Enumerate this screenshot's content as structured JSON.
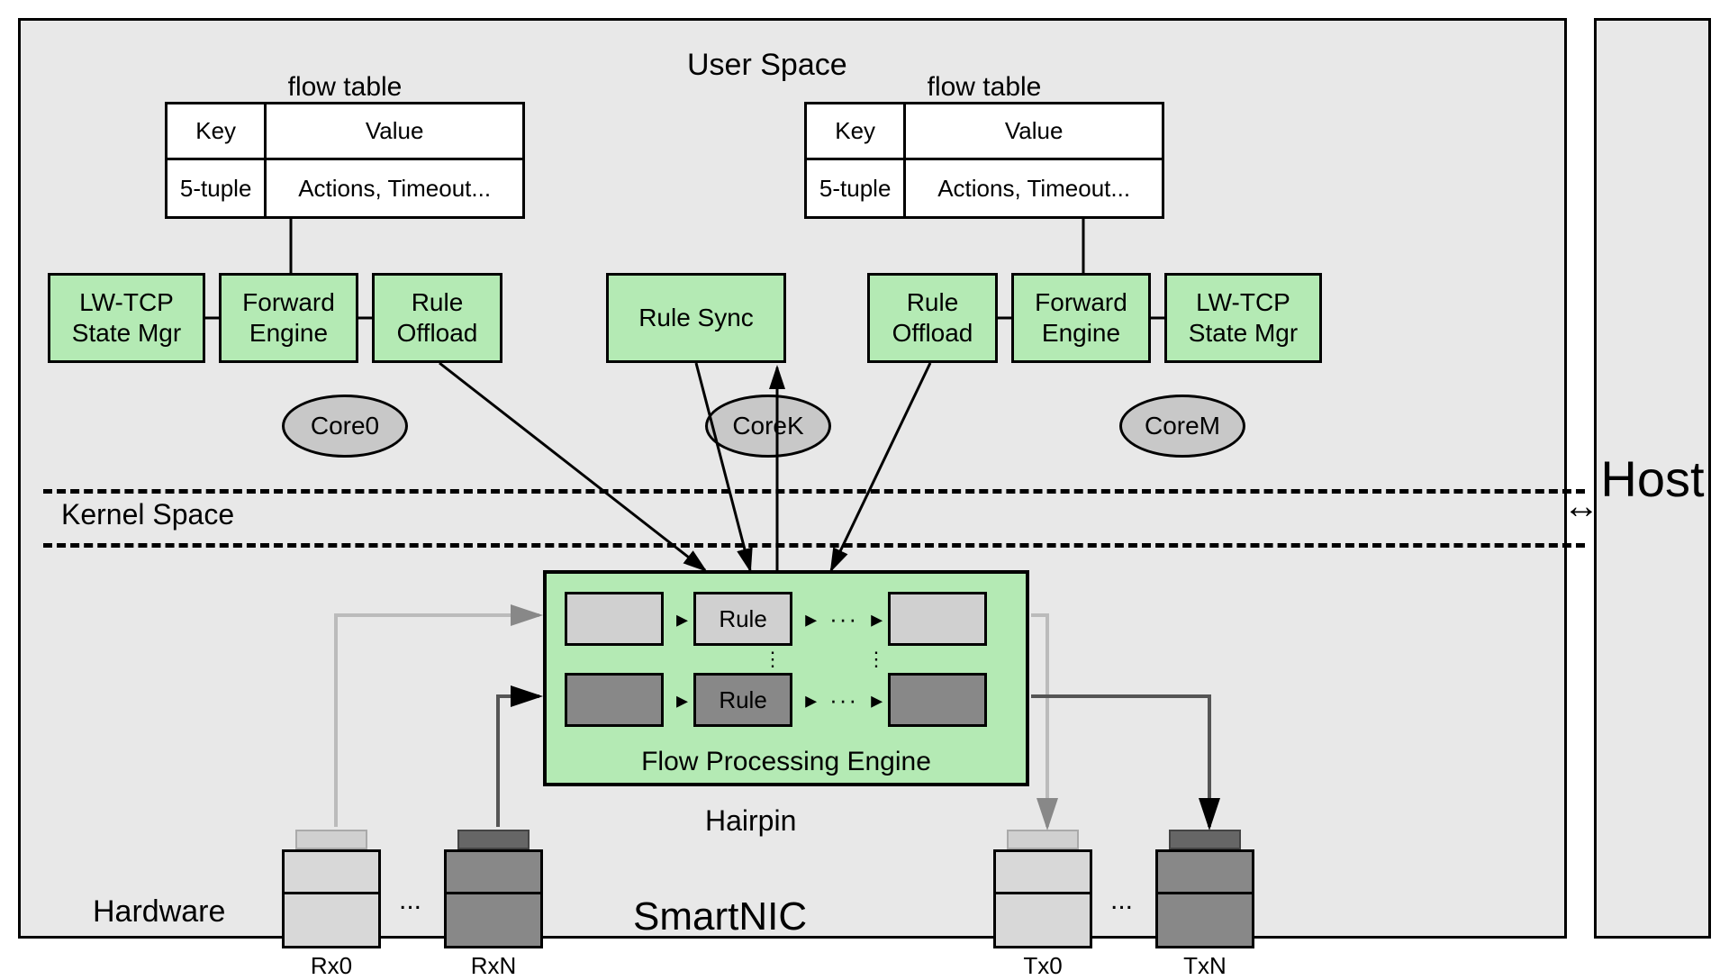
{
  "sections": {
    "user_space": "User Space",
    "kernel_space": "Kernel Space",
    "hardware": "Hardware",
    "smartnic": "SmartNIC",
    "hairpin": "Hairpin",
    "host": "Host"
  },
  "flow_table": {
    "title": "flow table",
    "header": {
      "key": "Key",
      "value": "Value"
    },
    "row": {
      "key": "5-tuple",
      "value": "Actions, Timeout..."
    }
  },
  "boxes": {
    "lwtcp": "LW-TCP\nState Mgr",
    "forward": "Forward\nEngine",
    "rule_offload": "Rule\nOffload",
    "rule_sync": "Rule Sync"
  },
  "cores": {
    "c0": "Core0",
    "ck": "CoreK",
    "cm": "CoreM"
  },
  "flow_engine": {
    "label": "Flow   Processing Engine",
    "rule": "Rule"
  },
  "ports": {
    "rx0": "Rx0",
    "rxn": "RxN",
    "tx0": "Tx0",
    "txn": "TxN",
    "dots": "..."
  }
}
